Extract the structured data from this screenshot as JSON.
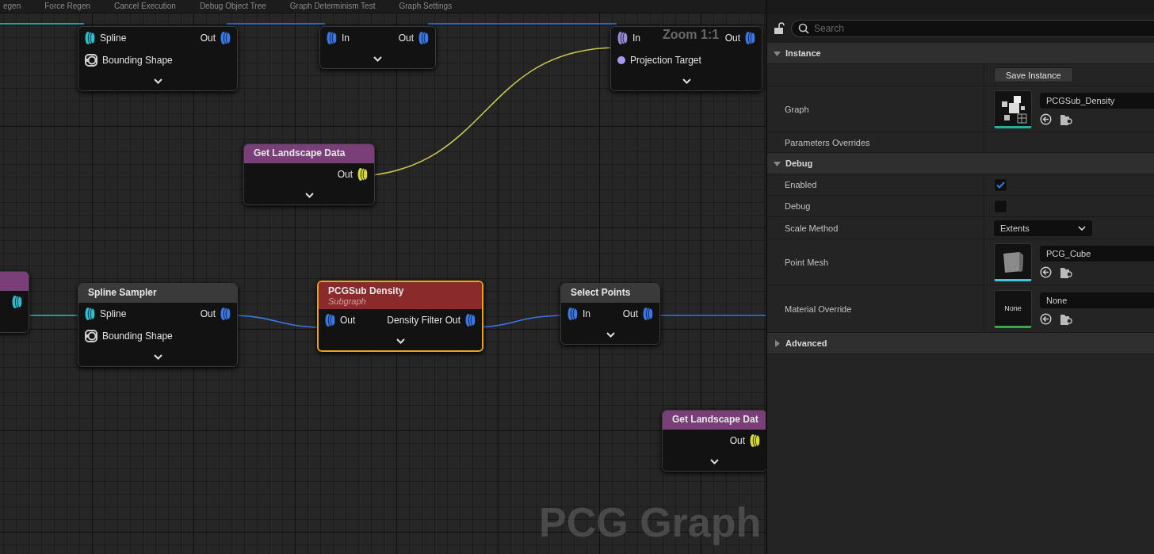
{
  "toolbar": [
    {
      "label": "egen"
    },
    {
      "label": "Force Regen"
    },
    {
      "label": "Cancel Execution"
    },
    {
      "label": "Debug Object Tree"
    },
    {
      "label": "Graph Determinism Test"
    },
    {
      "label": "Graph Settings"
    }
  ],
  "canvas": {
    "zoom_label": "Zoom 1:1",
    "watermark": "PCG Graph",
    "nodes": [
      {
        "selected": false,
        "inputs": [
          {
            "label": "Spline",
            "kind": "data",
            "color": "#2fbccc"
          },
          {
            "label": "Bounding Shape",
            "kind": "shape",
            "color": "#d0d0d0"
          }
        ],
        "outputs": [
          {
            "label": "Out",
            "kind": "data",
            "color": "#3a78e8"
          }
        ]
      },
      {
        "selected": false,
        "inputs": [
          {
            "label": "In",
            "kind": "data",
            "color": "#3a78e8"
          }
        ],
        "outputs": [
          {
            "label": "Out",
            "kind": "data",
            "color": "#3a78e8"
          }
        ]
      },
      {
        "selected": false,
        "inputs": [
          {
            "label": "In",
            "kind": "data",
            "color": "#9a8ad8"
          },
          {
            "label": "Projection Target",
            "kind": "dot",
            "color": "#a898f0"
          }
        ],
        "outputs": [
          {
            "label": "Out",
            "kind": "data",
            "color": "#3a78e8"
          }
        ]
      },
      {
        "title": "Get Landscape Data",
        "color": "#7a3f78",
        "selected": false,
        "outputs": [
          {
            "label": "Out",
            "kind": "data",
            "color": "#d8d838"
          }
        ]
      },
      {
        "color": "#7a3f78",
        "selected": false,
        "outputs": [
          {
            "kind": "data",
            "color": "#2fbccc"
          }
        ]
      },
      {
        "title": "Spline Sampler",
        "color": "#3a3a3a",
        "selected": false,
        "inputs": [
          {
            "label": "Spline",
            "kind": "data",
            "color": "#2fbccc"
          },
          {
            "label": "Bounding Shape",
            "kind": "shape",
            "color": "#d0d0d0"
          }
        ],
        "outputs": [
          {
            "label": "Out",
            "kind": "data",
            "color": "#3a78e8"
          }
        ]
      },
      {
        "title": "PCGSub Density",
        "subtitle": "Subgraph",
        "color": "#8a2a2a",
        "selected": true,
        "inputs": [
          {
            "label": "Out",
            "kind": "data",
            "color": "#3a78e8"
          }
        ],
        "outputs": [
          {
            "label": "Density Filter Out",
            "kind": "data",
            "color": "#3a78e8"
          }
        ]
      },
      {
        "title": "Select Points",
        "color": "#3a3a3a",
        "selected": false,
        "inputs": [
          {
            "label": "In",
            "kind": "data",
            "color": "#3a78e8"
          }
        ],
        "outputs": [
          {
            "label": "Out",
            "kind": "data",
            "color": "#3a78e8"
          }
        ]
      },
      {
        "title": "Get Landscape Dat",
        "color": "#7a3f78",
        "selected": false,
        "outputs": [
          {
            "label": "Out",
            "kind": "data",
            "color": "#d8d838"
          }
        ]
      }
    ]
  },
  "details": {
    "search": {
      "placeholder": "Search"
    },
    "locked": false,
    "sections": [
      {
        "title": "Instance",
        "expanded": true,
        "rows": [
          {
            "kind": "button",
            "value": "Save Instance"
          },
          {
            "kind": "asset",
            "label": "Graph",
            "value": "PCGSub_Density",
            "thumbnail": {
              "kind": "graph"
            }
          },
          {
            "kind": "plain",
            "label": "Parameters Overrides"
          }
        ]
      },
      {
        "title": "Debug",
        "expanded": true,
        "rows": [
          {
            "kind": "checkbox",
            "label": "Enabled",
            "checked": true
          },
          {
            "kind": "checkbox",
            "label": "Debug",
            "checked": false
          },
          {
            "kind": "dropdown",
            "label": "Scale Method",
            "value": "Extents"
          },
          {
            "kind": "asset",
            "label": "Point Mesh",
            "value": "PCG_Cube",
            "thumbnail": {
              "kind": "cube"
            }
          },
          {
            "kind": "asset",
            "label": "Material Override",
            "value": "None",
            "thumbnail": {
              "kind": "text",
              "text": "None"
            }
          }
        ]
      },
      {
        "title": "Advanced",
        "expanded": false
      }
    ]
  }
}
